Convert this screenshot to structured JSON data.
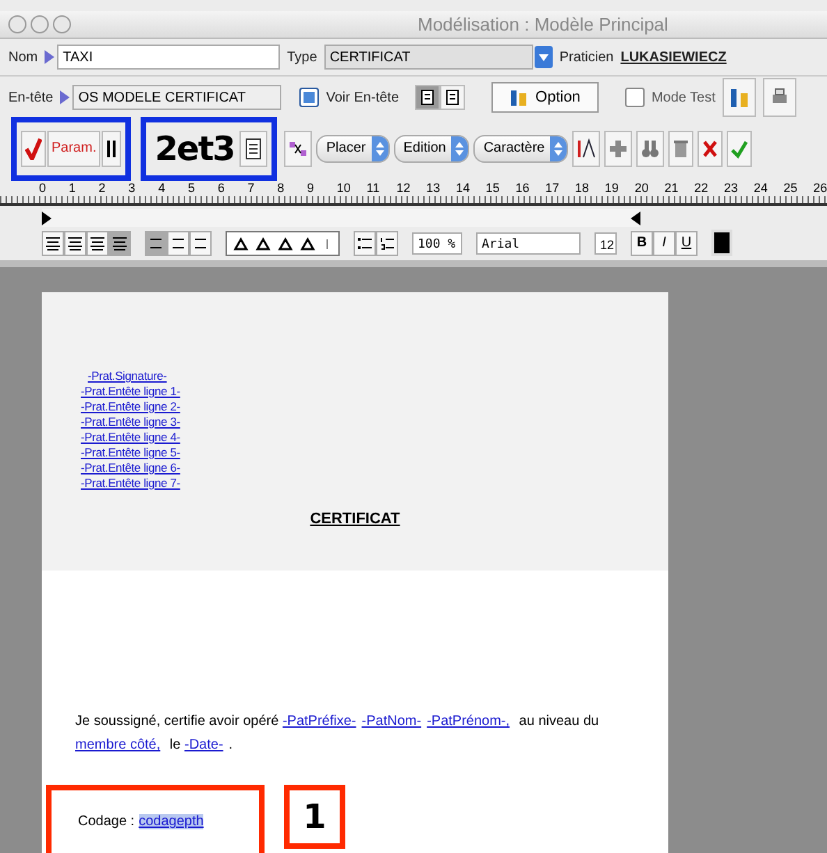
{
  "window": {
    "title": "Modélisation : Modèle Principal"
  },
  "nom": {
    "label": "Nom",
    "value": "TAXI"
  },
  "type": {
    "label": "Type",
    "value": "CERTIFICAT"
  },
  "praticien": {
    "label": "Praticien",
    "value": "LUKASIEWIECZ"
  },
  "entete": {
    "label": "En-tête",
    "value": "OS MODELE CERTIFICAT"
  },
  "voir_entete": {
    "label": "Voir En-tête",
    "checked": true
  },
  "view_toggles": [
    {
      "selected": true
    },
    {
      "selected": false
    }
  ],
  "option_button": "Option",
  "mode_test": {
    "label": "Mode Test",
    "checked": false
  },
  "param_button": "Param.",
  "menus": [
    "Placer",
    "Edition",
    "Caractère"
  ],
  "ruler": [
    "0",
    "1",
    "2",
    "3",
    "4",
    "5",
    "6",
    "7",
    "8",
    "9",
    "10",
    "11",
    "12",
    "13",
    "14",
    "15",
    "16",
    "17",
    "18",
    "19",
    "20",
    "21",
    "22",
    "23",
    "24",
    "25",
    "26"
  ],
  "align_buttons": [
    {
      "selected": false
    },
    {
      "selected": false
    },
    {
      "selected": false
    },
    {
      "selected": true
    }
  ],
  "spacing_buttons": [
    {
      "selected": true
    },
    {
      "selected": false
    },
    {
      "selected": false
    }
  ],
  "zoom": "100 %",
  "font": "Arial",
  "size": "12",
  "style_buttons": [
    {
      "label": "B",
      "selected": false
    },
    {
      "label": "I",
      "selected": false
    },
    {
      "label": "U",
      "selected": false
    }
  ],
  "document": {
    "header_links": [
      "-Prat.Signature-",
      "-Prat.Entête ligne 1-",
      "-Prat.Entête ligne 2-",
      "-Prat.Entête ligne 3-",
      "-Prat.Entête ligne 4-",
      "-Prat.Entête ligne 5-",
      "-Prat.Entête ligne 6-",
      "-Prat.Entête ligne 7-"
    ],
    "title": "CERTIFICAT",
    "paragraph": [
      {
        "kind": "text",
        "text": "Je soussigné, certifie avoir opéré "
      },
      {
        "kind": "link",
        "text": "-PatPréfixe-"
      },
      {
        "kind": "link",
        "text": "-PatNom-"
      },
      {
        "kind": "link",
        "text": "-PatPrénom-,"
      },
      {
        "kind": "text",
        "text": " au niveau du "
      },
      {
        "kind": "link",
        "text": "membre côté,"
      },
      {
        "kind": "text",
        "text": " le "
      },
      {
        "kind": "link",
        "text": "-Date-"
      },
      {
        "kind": "text",
        "text": "."
      }
    ],
    "codage_label": "Codage :",
    "codage_value": "codagepth"
  },
  "annotations": [
    {
      "text": "2et3"
    },
    {
      "text": "1"
    }
  ]
}
